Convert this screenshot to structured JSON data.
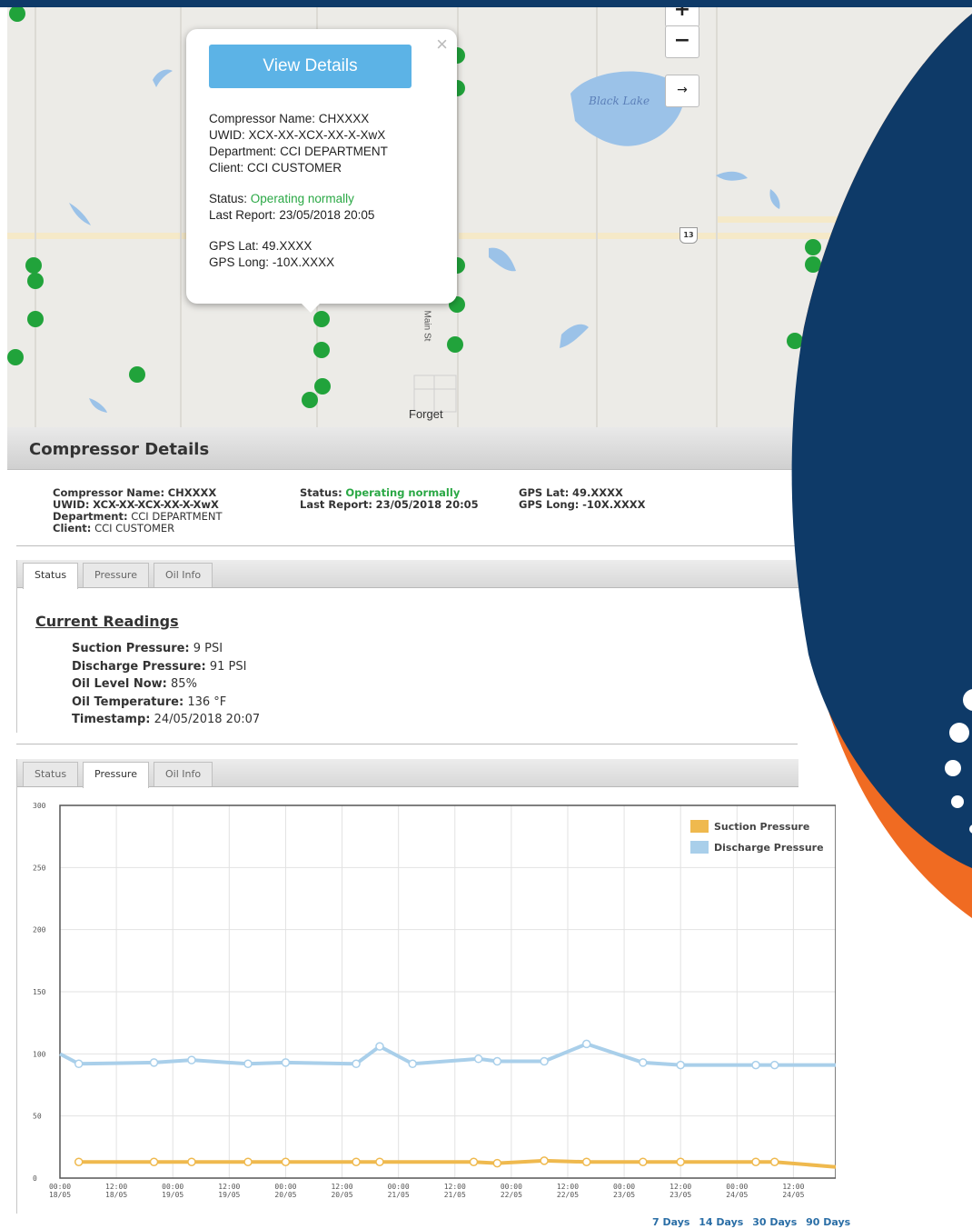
{
  "map": {
    "lake_label": "Black Lake",
    "town_label": "Forget",
    "street_label": "Main St",
    "highway_number": "13",
    "zoom_in": "+",
    "zoom_out": "−",
    "arrow": "→"
  },
  "popup": {
    "close": "×",
    "view_details": "View Details",
    "name_label": "Compressor Name:",
    "name_value": "CHXXXX",
    "uwid_label": "UWID:",
    "uwid_value": "XCX-XX-XCX-XX-X-XwX",
    "dept_label": "Department:",
    "dept_value": "CCI DEPARTMENT",
    "client_label": "Client:",
    "client_value": "CCI CUSTOMER",
    "status_label": "Status:",
    "status_value": "Operating normally",
    "report_label": "Last Report:",
    "report_value": "23/05/2018 20:05",
    "lat_label": "GPS Lat:",
    "lat_value": "49.XXXX",
    "long_label": "GPS Long:",
    "long_value": "-10X.XXXX"
  },
  "details": {
    "title": "Compressor Details",
    "name_label": "Compressor Name:",
    "name_value": "CHXXXX",
    "uwid_label": "UWID:",
    "uwid_value": "XCX-XX-XCX-XX-X-XwX",
    "dept_label": "Department:",
    "dept_value": "CCI DEPARTMENT",
    "client_label": "Client:",
    "client_value": "CCI CUSTOMER",
    "status_label": "Status:",
    "status_value": "Operating normally",
    "report_label": "Last Report:",
    "report_value": "23/05/2018 20:05",
    "lat_label": "GPS Lat:",
    "lat_value": "49.XXXX",
    "long_label": "GPS Long:",
    "long_value": "-10X.XXXX"
  },
  "tabs": [
    "Status",
    "Pressure",
    "Oil Info"
  ],
  "readings": {
    "title": "Current Readings",
    "suction_label": "Suction Pressure:",
    "suction_value": "9 PSI",
    "discharge_label": "Discharge Pressure:",
    "discharge_value": "91 PSI",
    "oil_level_label": "Oil Level Now:",
    "oil_level_value": "85%",
    "oil_temp_label": "Oil Temperature:",
    "oil_temp_value": "136 °F",
    "timestamp_label": "Timestamp:",
    "timestamp_value": "24/05/2018 20:07"
  },
  "range_links": [
    "7 Days",
    "14 Days",
    "30 Days",
    "90 Days"
  ],
  "chart_data": {
    "type": "line",
    "ylim": [
      0,
      300
    ],
    "yticks": [
      0,
      50,
      100,
      150,
      200,
      250,
      300
    ],
    "xlim": [
      0,
      165
    ],
    "xticks": [
      {
        "t": 0,
        "time": "00:00",
        "date": "18/05"
      },
      {
        "t": 12,
        "time": "12:00",
        "date": "18/05"
      },
      {
        "t": 24,
        "time": "00:00",
        "date": "19/05"
      },
      {
        "t": 36,
        "time": "12:00",
        "date": "19/05"
      },
      {
        "t": 48,
        "time": "00:00",
        "date": "20/05"
      },
      {
        "t": 60,
        "time": "12:00",
        "date": "20/05"
      },
      {
        "t": 72,
        "time": "00:00",
        "date": "21/05"
      },
      {
        "t": 84,
        "time": "12:00",
        "date": "21/05"
      },
      {
        "t": 96,
        "time": "00:00",
        "date": "22/05"
      },
      {
        "t": 108,
        "time": "12:00",
        "date": "22/05"
      },
      {
        "t": 120,
        "time": "00:00",
        "date": "23/05"
      },
      {
        "t": 132,
        "time": "12:00",
        "date": "23/05"
      },
      {
        "t": 144,
        "time": "00:00",
        "date": "24/05"
      },
      {
        "t": 156,
        "time": "12:00",
        "date": "24/05"
      }
    ],
    "series": [
      {
        "name": "Suction Pressure",
        "color": "#efb94e",
        "x": [
          4,
          20,
          28,
          40,
          48,
          63,
          68,
          88,
          93,
          103,
          112,
          124,
          132,
          148,
          152,
          168
        ],
        "y": [
          13,
          13,
          13,
          13,
          13,
          13,
          13,
          13,
          12,
          14,
          13,
          13,
          13,
          13,
          13,
          9
        ]
      },
      {
        "name": "Discharge Pressure",
        "color": "#a9cfea",
        "x": [
          -3,
          4,
          20,
          28,
          40,
          48,
          63,
          68,
          75,
          89,
          93,
          103,
          112,
          124,
          132,
          148,
          152,
          168
        ],
        "y": [
          100,
          92,
          93,
          95,
          92,
          93,
          92,
          106,
          92,
          96,
          94,
          94,
          108,
          93,
          91,
          91,
          91,
          91
        ]
      }
    ]
  }
}
